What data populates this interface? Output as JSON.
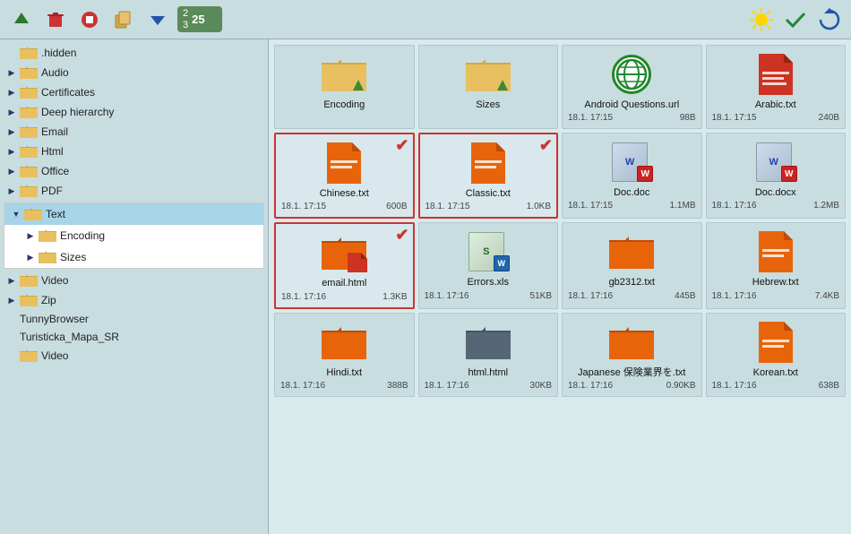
{
  "toolbar": {
    "buttons": [
      "up-arrow",
      "delete",
      "stop",
      "copy",
      "move-down",
      "badge"
    ],
    "badge_count_top": "2",
    "badge_count_bottom": "3",
    "badge_total": "25"
  },
  "sidebar": {
    "items": [
      {
        "label": ".hidden",
        "indent": 1,
        "arrow": false,
        "folder": true,
        "selected": false
      },
      {
        "label": "Audio",
        "indent": 1,
        "arrow": true,
        "folder": true,
        "selected": false
      },
      {
        "label": "Certificates",
        "indent": 1,
        "arrow": true,
        "folder": true,
        "selected": false
      },
      {
        "label": "Deep hierarchy",
        "indent": 1,
        "arrow": true,
        "folder": true,
        "selected": false
      },
      {
        "label": "Email",
        "indent": 1,
        "arrow": true,
        "folder": true,
        "selected": false
      },
      {
        "label": "Html",
        "indent": 1,
        "arrow": true,
        "folder": true,
        "selected": false
      },
      {
        "label": "Office",
        "indent": 1,
        "arrow": true,
        "folder": true,
        "selected": false
      },
      {
        "label": "PDF",
        "indent": 1,
        "arrow": true,
        "folder": true,
        "selected": false
      }
    ],
    "text_group": {
      "text_label": "Text",
      "encoding_label": "Encoding",
      "sizes_label": "Sizes"
    },
    "items_after": [
      {
        "label": "Video",
        "indent": 1,
        "arrow": true,
        "folder": true
      },
      {
        "label": "Zip",
        "indent": 1,
        "arrow": true,
        "folder": true
      },
      {
        "label": "TunnyBrowser",
        "indent": 0,
        "arrow": false,
        "folder": false
      },
      {
        "label": "Turisticka_Mapa_SR",
        "indent": 0,
        "arrow": false,
        "folder": false
      },
      {
        "label": "Video",
        "indent": 0,
        "arrow": false,
        "folder": true
      }
    ]
  },
  "files": [
    {
      "name": "Encoding",
      "type": "folder",
      "date": "",
      "size": "",
      "selected": false,
      "checkmark": false
    },
    {
      "name": "Sizes",
      "type": "folder",
      "date": "",
      "size": "",
      "selected": false,
      "checkmark": false
    },
    {
      "name": "Android Questions.url",
      "type": "url",
      "date": "18.1. 17:15",
      "size": "98B",
      "selected": false,
      "checkmark": false
    },
    {
      "name": "Arabic.txt",
      "type": "txt",
      "date": "18.1. 17:15",
      "size": "240B",
      "selected": false,
      "checkmark": false
    },
    {
      "name": "Chinese.txt",
      "type": "txt-orange",
      "date": "18.1. 17:15",
      "size": "600B",
      "selected": true,
      "checkmark": true
    },
    {
      "name": "Classic.txt",
      "type": "txt-orange",
      "date": "18.1. 17:15",
      "size": "1.0KB",
      "selected": true,
      "checkmark": true
    },
    {
      "name": "Doc.doc",
      "type": "doc",
      "date": "18.1. 17:15",
      "size": "1.1MB",
      "selected": false,
      "checkmark": false
    },
    {
      "name": "Doc.docx",
      "type": "docx",
      "date": "18.1. 17:16",
      "size": "1.2MB",
      "selected": false,
      "checkmark": false
    },
    {
      "name": "email.html",
      "type": "txt-orange",
      "date": "18.1. 17:16",
      "size": "1.3KB",
      "selected": true,
      "checkmark": true
    },
    {
      "name": "Errors.xls",
      "type": "xls",
      "date": "18.1. 17:16",
      "size": "51KB",
      "selected": false,
      "checkmark": false
    },
    {
      "name": "gb2312.txt",
      "type": "folder-orange",
      "date": "18.1. 17:16",
      "size": "445B",
      "selected": false,
      "checkmark": false
    },
    {
      "name": "Hebrew.txt",
      "type": "txt-orange",
      "date": "18.1. 17:16",
      "size": "7.4KB",
      "selected": false,
      "checkmark": false
    },
    {
      "name": "Hindi.txt",
      "type": "folder-orange-sm",
      "date": "18.1. 17:16",
      "size": "388B",
      "selected": false,
      "checkmark": false
    },
    {
      "name": "html.html",
      "type": "folder-dark",
      "date": "18.1. 17:16",
      "size": "30KB",
      "selected": false,
      "checkmark": false
    },
    {
      "name": "Japanese 保険業界を.txt",
      "type": "folder-orange-sm",
      "date": "18.1. 17:16",
      "size": "0.90KB",
      "selected": false,
      "checkmark": false
    },
    {
      "name": "Korean.txt",
      "type": "txt-orange",
      "date": "18.1. 17:16",
      "size": "638B",
      "selected": false,
      "checkmark": false
    }
  ]
}
